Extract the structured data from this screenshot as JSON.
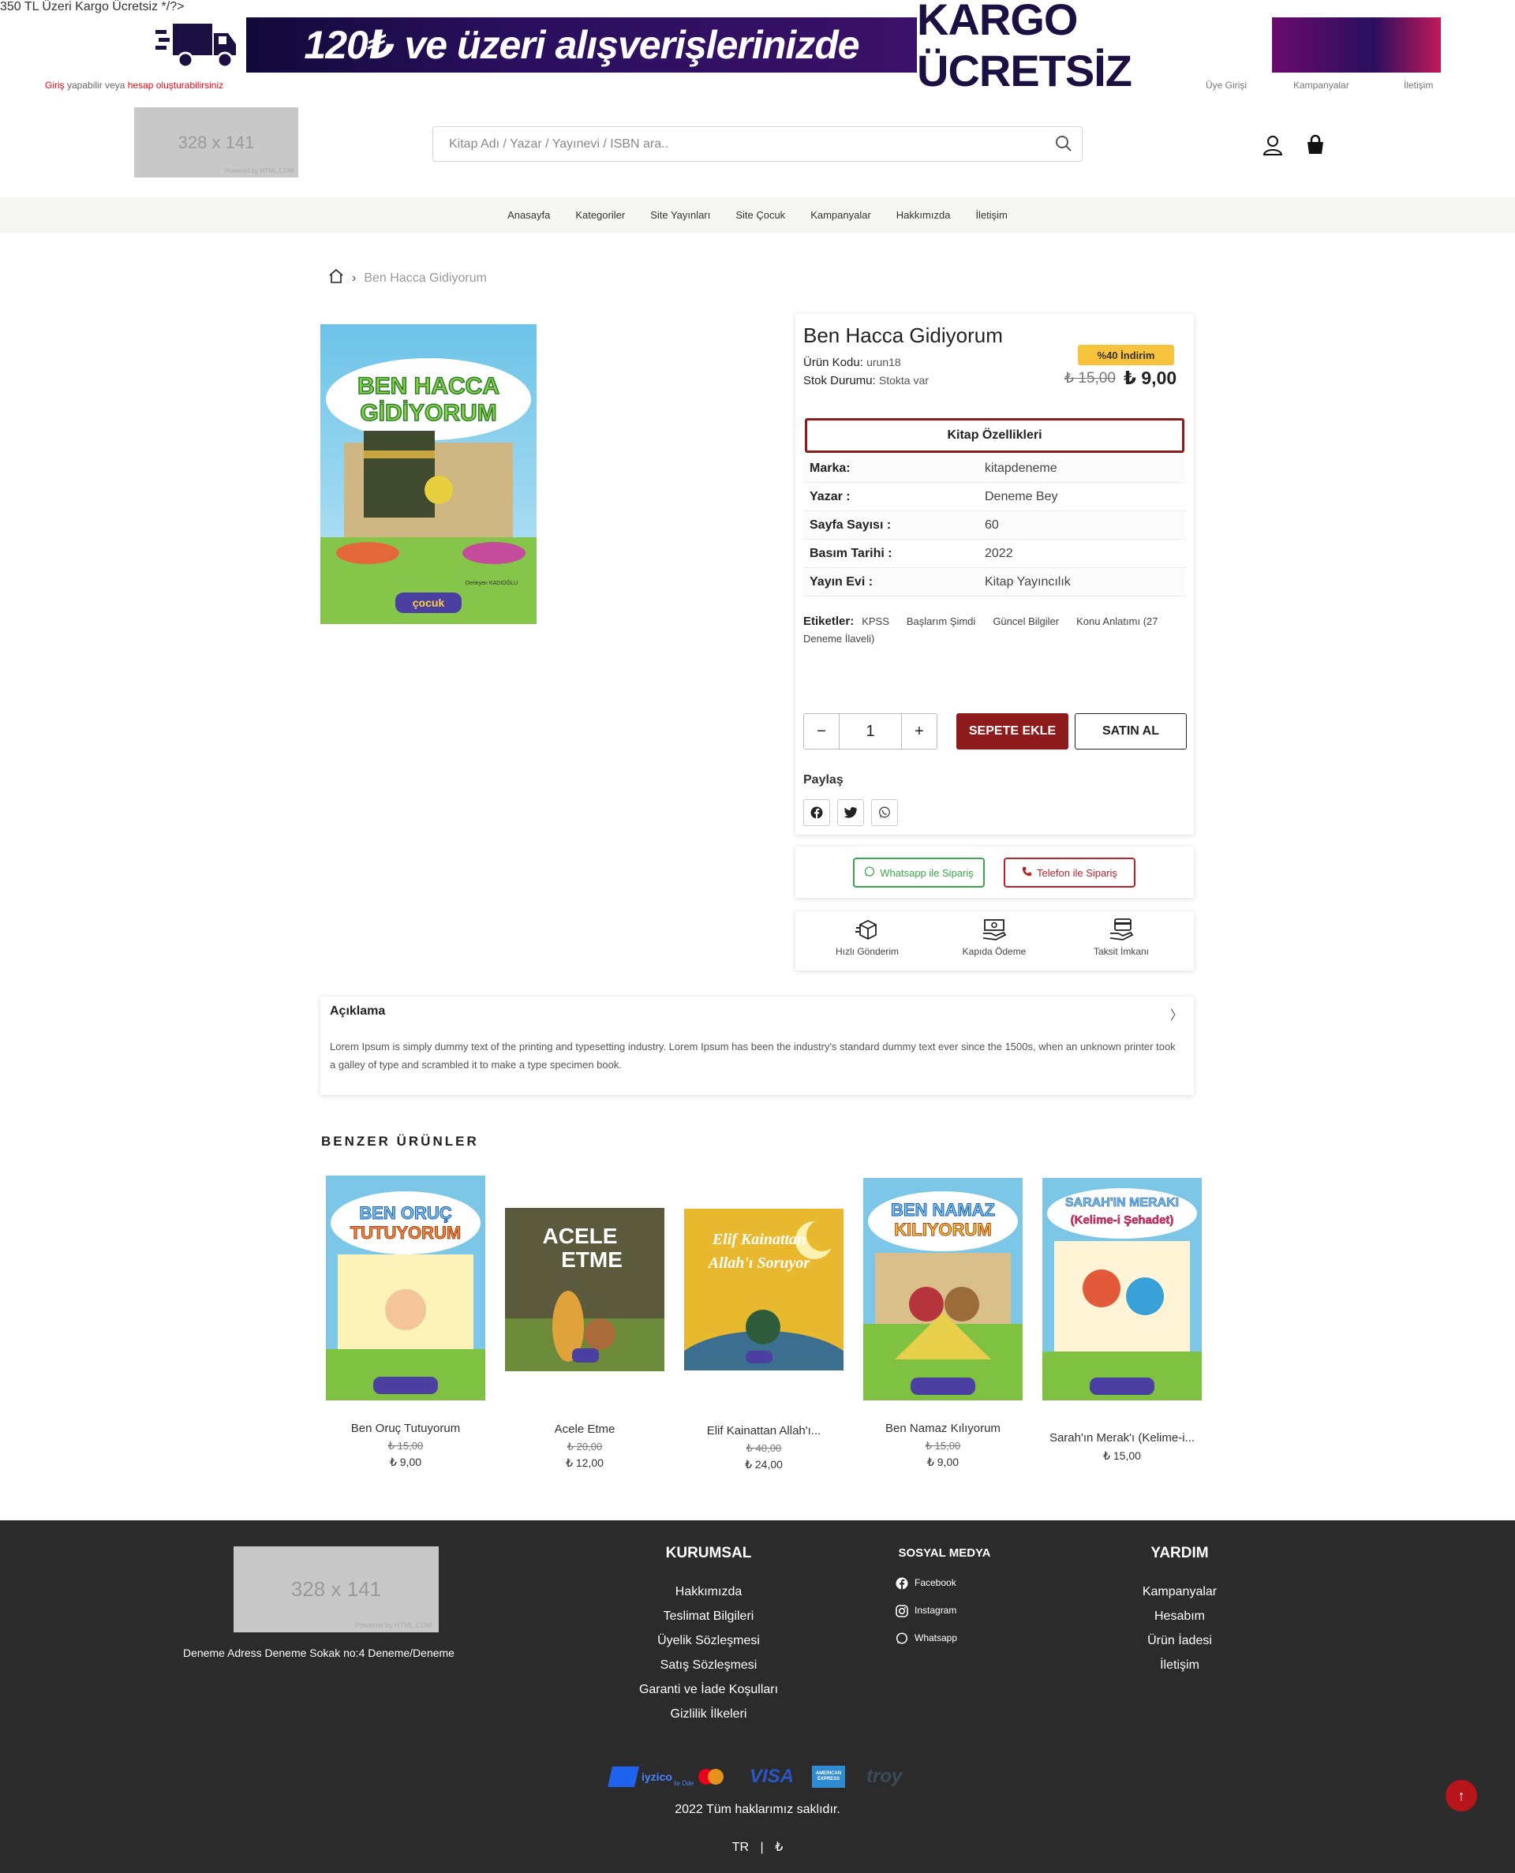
{
  "topbar": {
    "text": "350 TL Üzeri Kargo Ücretsiz */?>"
  },
  "banner": {
    "left_text": "120₺ ve üzeri alışverişlerinizde",
    "right_text": "KARGO ÜCRETSİZ"
  },
  "login": {
    "prefix": "Giriş",
    "mid": " yapabilir veya ",
    "link": "hesap oluşturabilirsiniz"
  },
  "toplinks": [
    "Üye Girişi",
    "Kampanyalar",
    "İletişim"
  ],
  "header": {
    "logo_text": "328 x 141",
    "logo_sub": "Powered by HTML.COM",
    "search_placeholder": "Kitap Adı / Yazar / Yayınevi / ISBN ara.."
  },
  "nav": [
    "Anasayfa",
    "Kategoriler",
    "Site Yayınları",
    "Site Çocuk",
    "Kampanyalar",
    "Hakkımızda",
    "İletişim"
  ],
  "breadcrumb": {
    "current": "Ben Hacca Gidiyorum"
  },
  "product": {
    "title": "Ben Hacca Gidiyorum",
    "code_label": "Ürün Kodu:",
    "code": "urun18",
    "stock_label": "Stok Durumu:",
    "stock": "Stokta var",
    "discount": "%40 İndirim",
    "old_price": "₺ 15,00",
    "price": "₺ 9,00",
    "specs_title": "Kitap Özellikleri",
    "specs": [
      {
        "k": "Marka:",
        "v": "kitapdeneme"
      },
      {
        "k": "Yazar :",
        "v": "Deneme Bey"
      },
      {
        "k": "Sayfa Sayısı :",
        "v": "60"
      },
      {
        "k": "Basım Tarihi :",
        "v": "2022"
      },
      {
        "k": "Yayın Evi :",
        "v": "Kitap Yayıncılık"
      }
    ],
    "tags_label": "Etiketler:",
    "tags": [
      "KPSS",
      "Başlarım Şimdi",
      "Güncel Bilgiler",
      "Konu Anlatımı (27 Deneme İlaveli)"
    ],
    "qty": "1",
    "add_to_cart": "SEPETE EKLE",
    "buy_now": "SATIN AL",
    "share_label": "Paylaş",
    "whatsapp_order": "Whatsapp ile Sipariş",
    "phone_order": "Telefon ile Sipariş",
    "features": [
      "Hızlı Gönderim",
      "Kapıda Ödeme",
      "Taksit İmkanı"
    ],
    "cover_title_1": "BEN HACCA",
    "cover_title_2": "GİDİYORUM",
    "cover_author": "Derleyen KADIOĞLU",
    "cover_brand": "çocuk"
  },
  "description": {
    "title": "Açıklama",
    "text": "Lorem Ipsum is simply dummy text of the printing and typesetting industry. Lorem Ipsum has been the industry's standard dummy text ever since the 1500s, when an unknown printer took a galley of type and scrambled it to make a type specimen book."
  },
  "similar": {
    "title": "BENZER ÜRÜNLER",
    "items": [
      {
        "name": "Ben Oruç Tutuyorum",
        "old": "₺ 15,00",
        "price": "₺ 9,00",
        "c1": "BEN ORUÇ",
        "c2": "TUTUYORUM",
        "bg": "#7cc6e8"
      },
      {
        "name": "Acele Etme",
        "old": "₺ 20,00",
        "price": "₺ 12,00",
        "c1": "ACELE",
        "c2": "ETME",
        "bg": "#5c5a3c"
      },
      {
        "name": "Elif Kainattan Allah'ı...",
        "old": "₺ 40,00",
        "price": "₺ 24,00",
        "c1": "Elif Kainattan",
        "c2": "Allah'ı Soruyor",
        "bg": "#e8b82e"
      },
      {
        "name": "Ben Namaz Kılıyorum",
        "old": "₺ 15,00",
        "price": "₺ 9,00",
        "c1": "BEN NAMAZ",
        "c2": "KILIYORUM",
        "bg": "#7cc6e8"
      },
      {
        "name": "Sarah'ın Merak'ı (Kelime-i...",
        "old": "",
        "price": "₺ 15,00",
        "c1": "SARAH'IN MERAKI",
        "c2": "(Kelime-i Şehadet)",
        "bg": "#7cc6e8"
      }
    ]
  },
  "footer": {
    "logo_text": "328 x 141",
    "logo_sub": "Powered by HTML.COM",
    "address": "Deneme Adress Deneme Sokak no:4 Deneme/Deneme",
    "kurumsal": {
      "title": "KURUMSAL",
      "items": [
        "Hakkımızda",
        "Teslimat Bilgileri",
        "Üyelik Sözleşmesi",
        "Satış Sözleşmesi",
        "Garanti ve İade Koşulları",
        "Gizlilik İlkeleri"
      ]
    },
    "sosyal": {
      "title": "SOSYAL MEDYA",
      "items": [
        "Facebook",
        "Instagram",
        "Whatsapp"
      ]
    },
    "yardim": {
      "title": "YARDIM",
      "items": [
        "Kampanyalar",
        "Hesabım",
        "Ürün İadesi",
        "İletişim"
      ]
    },
    "payments": [
      "iyzico",
      "mastercard",
      "VISA",
      "AMERICAN EXPRESS",
      "troy"
    ],
    "iyzico_sub": "ile Öde",
    "copyright": "2022 Tüm haklarımız saklıdır.",
    "lang": "TR",
    "currency": "₺"
  },
  "colors": {
    "primary": "#8e1b1b",
    "accent": "#e30a17",
    "badge": "#f7c33c",
    "footer_bg": "#2b2b2b",
    "nav_bg": "#f6f6f4"
  }
}
